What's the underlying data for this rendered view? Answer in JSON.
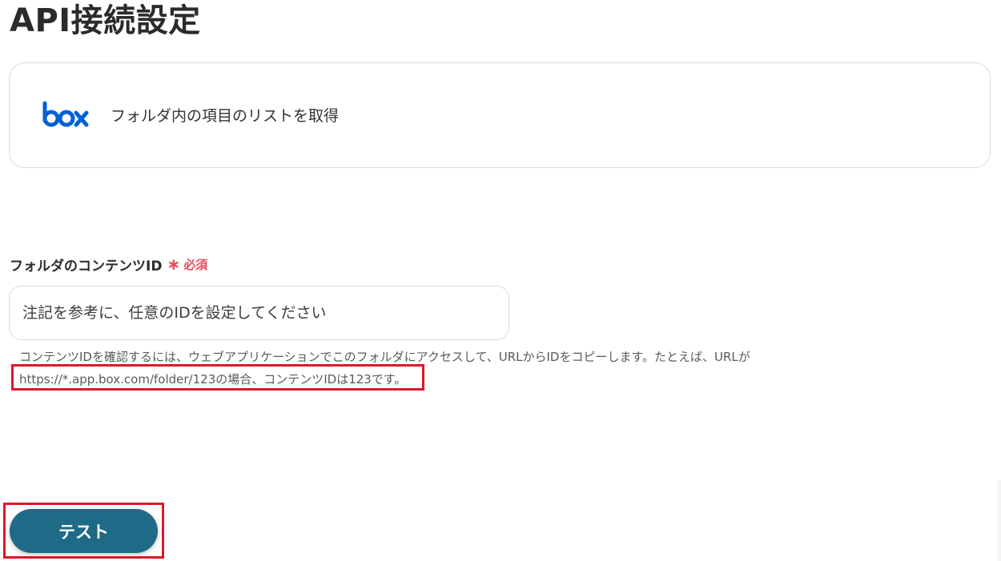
{
  "page": {
    "title": "API接続設定"
  },
  "action": {
    "app_icon": "box-logo",
    "app_name": "box",
    "label": "フォルダ内の項目のリストを取得",
    "brand_color": "#0061D5"
  },
  "field": {
    "label": "フォルダのコンテンツID",
    "required_symbol": "∗",
    "required_text": "必須",
    "placeholder": "注記を参考に、任意のIDを設定してください",
    "value": "",
    "help_line1": "コンテンツIDを確認するには、ウェブアプリケーションでこのフォルダにアクセスして、URLからIDをコピーします。たとえば、URLが",
    "help_line2": "https://*.app.box.com/folder/123の場合、コンテンツIDは123です。"
  },
  "buttons": {
    "test_label": "テスト"
  },
  "colors": {
    "accent": "#1f6a86",
    "required": "#e84b5b",
    "highlight": "#e0162b"
  }
}
